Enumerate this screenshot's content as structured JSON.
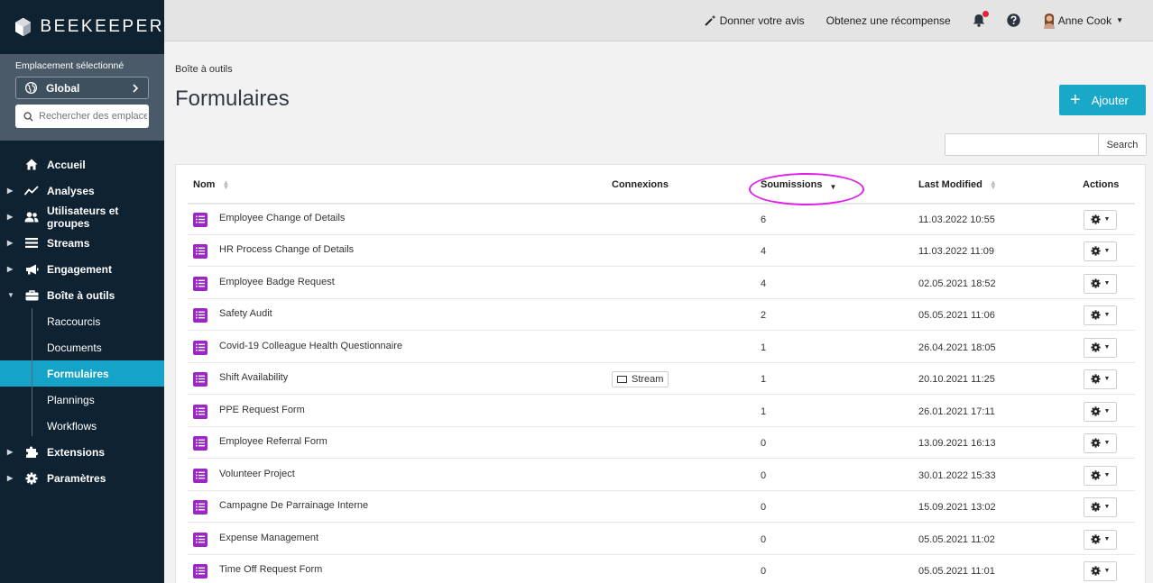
{
  "app": {
    "brand": "BEEKEEPER"
  },
  "location": {
    "label": "Emplacement sélectionné",
    "selected": "Global",
    "search_placeholder": "Rechercher des emplacements"
  },
  "sidebar": {
    "items": [
      {
        "label": "Accueil",
        "icon": "home-icon",
        "caret": "",
        "style": "bold"
      },
      {
        "label": "Analyses",
        "icon": "chart-line-icon",
        "caret": "▶",
        "style": "bold"
      },
      {
        "label": "Utilisateurs et groupes",
        "icon": "users-icon",
        "caret": "▶",
        "style": "bold"
      },
      {
        "label": "Streams",
        "icon": "list-icon",
        "caret": "▶",
        "style": "bold"
      },
      {
        "label": "Engagement",
        "icon": "megaphone-icon",
        "caret": "▶",
        "style": "bold"
      },
      {
        "label": "Boîte à outils",
        "icon": "toolbox-icon",
        "caret": "▼",
        "style": "bold"
      },
      {
        "label": "Raccourcis",
        "icon": "",
        "caret": "",
        "style": "sub"
      },
      {
        "label": "Documents",
        "icon": "",
        "caret": "",
        "style": "sub"
      },
      {
        "label": "Formulaires",
        "icon": "",
        "caret": "",
        "style": "active"
      },
      {
        "label": "Plannings",
        "icon": "",
        "caret": "",
        "style": "sub"
      },
      {
        "label": "Workflows",
        "icon": "",
        "caret": "",
        "style": "sub"
      },
      {
        "label": "Extensions",
        "icon": "puzzle-icon",
        "caret": "▶",
        "style": "bold"
      },
      {
        "label": "Paramètres",
        "icon": "gear-icon",
        "caret": "▶",
        "style": "bold"
      }
    ]
  },
  "topbar": {
    "feedback": "Donner votre avis",
    "reward": "Obtenez une récompense",
    "user": "Anne Cook"
  },
  "breadcrumb": "Boîte à outils",
  "page_title": "Formulaires",
  "add_button": "Ajouter",
  "search_button": "Search",
  "table": {
    "headers": {
      "name": "Nom",
      "connections": "Connexions",
      "submissions": "Soumissions",
      "modified": "Last Modified",
      "actions": "Actions"
    },
    "rows": [
      {
        "name": "Employee Change of Details",
        "connection": "",
        "submissions": "6",
        "modified": "11.03.2022 10:55"
      },
      {
        "name": "HR Process Change of Details",
        "connection": "",
        "submissions": "4",
        "modified": "11.03.2022 11:09"
      },
      {
        "name": "Employee Badge Request",
        "connection": "",
        "submissions": "4",
        "modified": "02.05.2021 18:52"
      },
      {
        "name": "Safety Audit",
        "connection": "",
        "submissions": "2",
        "modified": "05.05.2021 11:06"
      },
      {
        "name": "Covid-19 Colleague Health Questionnaire",
        "connection": "",
        "submissions": "1",
        "modified": "26.04.2021 18:05"
      },
      {
        "name": "Shift Availability",
        "connection": "Stream",
        "submissions": "1",
        "modified": "20.10.2021 11:25"
      },
      {
        "name": "PPE Request Form",
        "connection": "",
        "submissions": "1",
        "modified": "26.01.2021 17:11"
      },
      {
        "name": "Employee Referral Form",
        "connection": "",
        "submissions": "0",
        "modified": "13.09.2021 16:13"
      },
      {
        "name": "Volunteer Project",
        "connection": "",
        "submissions": "0",
        "modified": "30.01.2022 15:33"
      },
      {
        "name": "Campagne De Parrainage Interne",
        "connection": "",
        "submissions": "0",
        "modified": "15.09.2021 13:02"
      },
      {
        "name": "Expense Management",
        "connection": "",
        "submissions": "0",
        "modified": "05.05.2021 11:02"
      },
      {
        "name": "Time Off Request Form",
        "connection": "",
        "submissions": "0",
        "modified": "05.05.2021 11:01"
      }
    ]
  },
  "colors": {
    "sidebar_bg": "#0f2232",
    "accent": "#15a3c7",
    "form_icon": "#9b27c4",
    "highlight": "#e020e8",
    "notification": "#e0243a"
  }
}
